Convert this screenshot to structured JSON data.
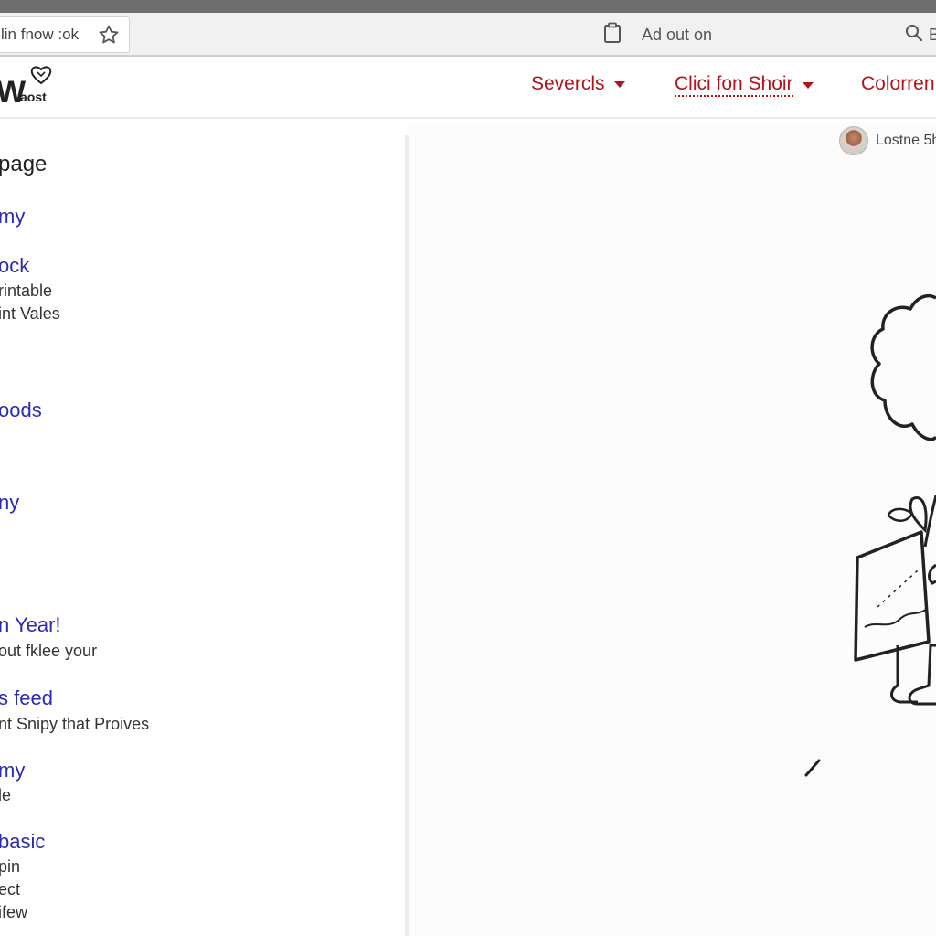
{
  "browser": {
    "url_text": "lin fnow :ok",
    "ad_text": "Ad out on",
    "search_text": "B"
  },
  "header": {
    "logo_letter": "W",
    "logo_small": "aost",
    "nav": [
      {
        "label": "Severcls"
      },
      {
        "label": "Clici fon Shoir"
      },
      {
        "label": "Colorren"
      }
    ]
  },
  "sidebar": {
    "title": "page",
    "items": [
      {
        "text": "my",
        "kind": "link"
      },
      {
        "text": "ock",
        "kind": "link"
      },
      {
        "text": "rintable",
        "kind": "desc"
      },
      {
        "text": "int Vales",
        "kind": "desc"
      },
      {
        "text": "oods",
        "kind": "link"
      },
      {
        "text": "ny",
        "kind": "link"
      },
      {
        "text": "n Year!",
        "kind": "link"
      },
      {
        "text": "out fklee your",
        "kind": "desc"
      },
      {
        "text": "s feed",
        "kind": "link"
      },
      {
        "text": "nt Snipy that Proives",
        "kind": "desc"
      },
      {
        "text": "my",
        "kind": "link"
      },
      {
        "text": "le",
        "kind": "desc"
      },
      {
        "text": "basic",
        "kind": "link"
      },
      {
        "text": "pin",
        "kind": "desc"
      },
      {
        "text": "ect",
        "kind": "desc"
      },
      {
        "text": "ifew",
        "kind": "desc"
      }
    ]
  },
  "user": {
    "name": "Lostne 5h"
  },
  "icons": {
    "star": "star-icon",
    "clipboard": "clipboard-icon",
    "search": "search-icon",
    "caret": "caret-down-icon",
    "heart": "heart-icon"
  },
  "colors": {
    "nav": "#b3121c",
    "link": "#2b2bb3"
  }
}
